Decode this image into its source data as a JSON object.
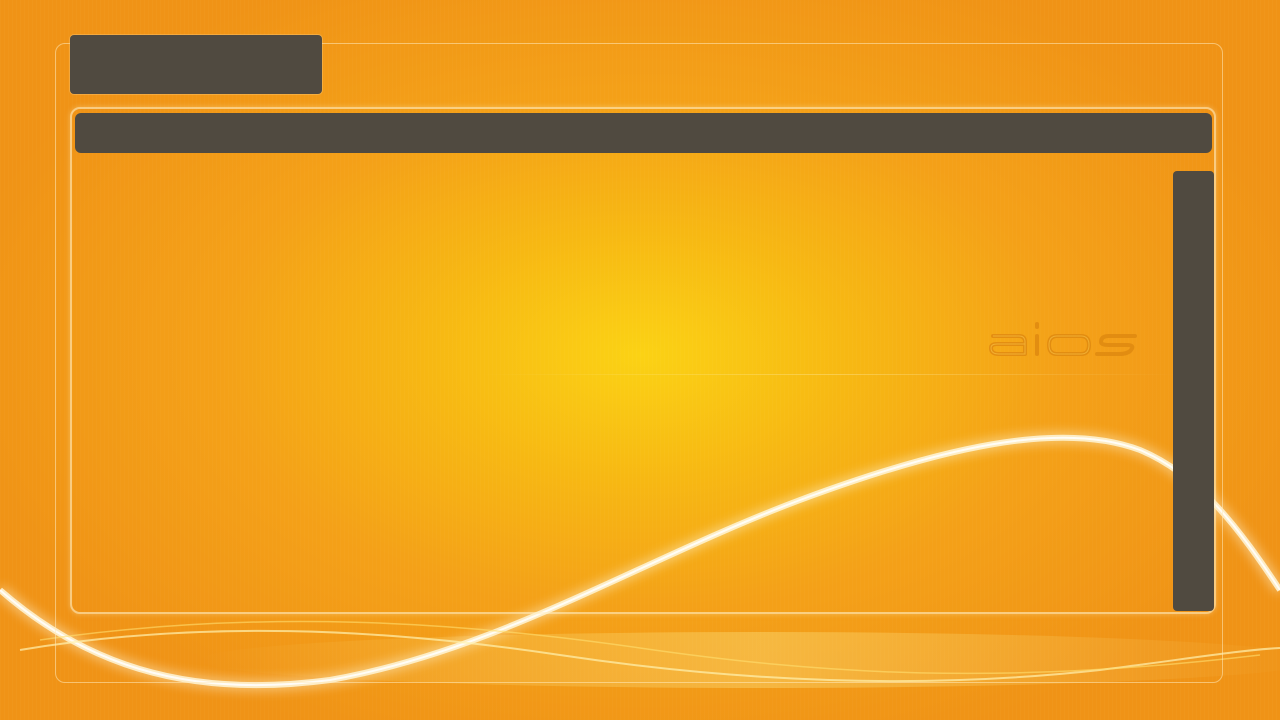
{
  "brand": {
    "logo_text": "aios",
    "logo_icon": "aios-logo"
  },
  "colors": {
    "background_center": "#fbd214",
    "background_edge": "#f09316",
    "panel_dark": "#504a40",
    "frame_light": "#fff0c8",
    "logo_outline": "#e08a10"
  },
  "window": {
    "title": "",
    "header": "",
    "scrollbar_icon": "scrollbar"
  }
}
